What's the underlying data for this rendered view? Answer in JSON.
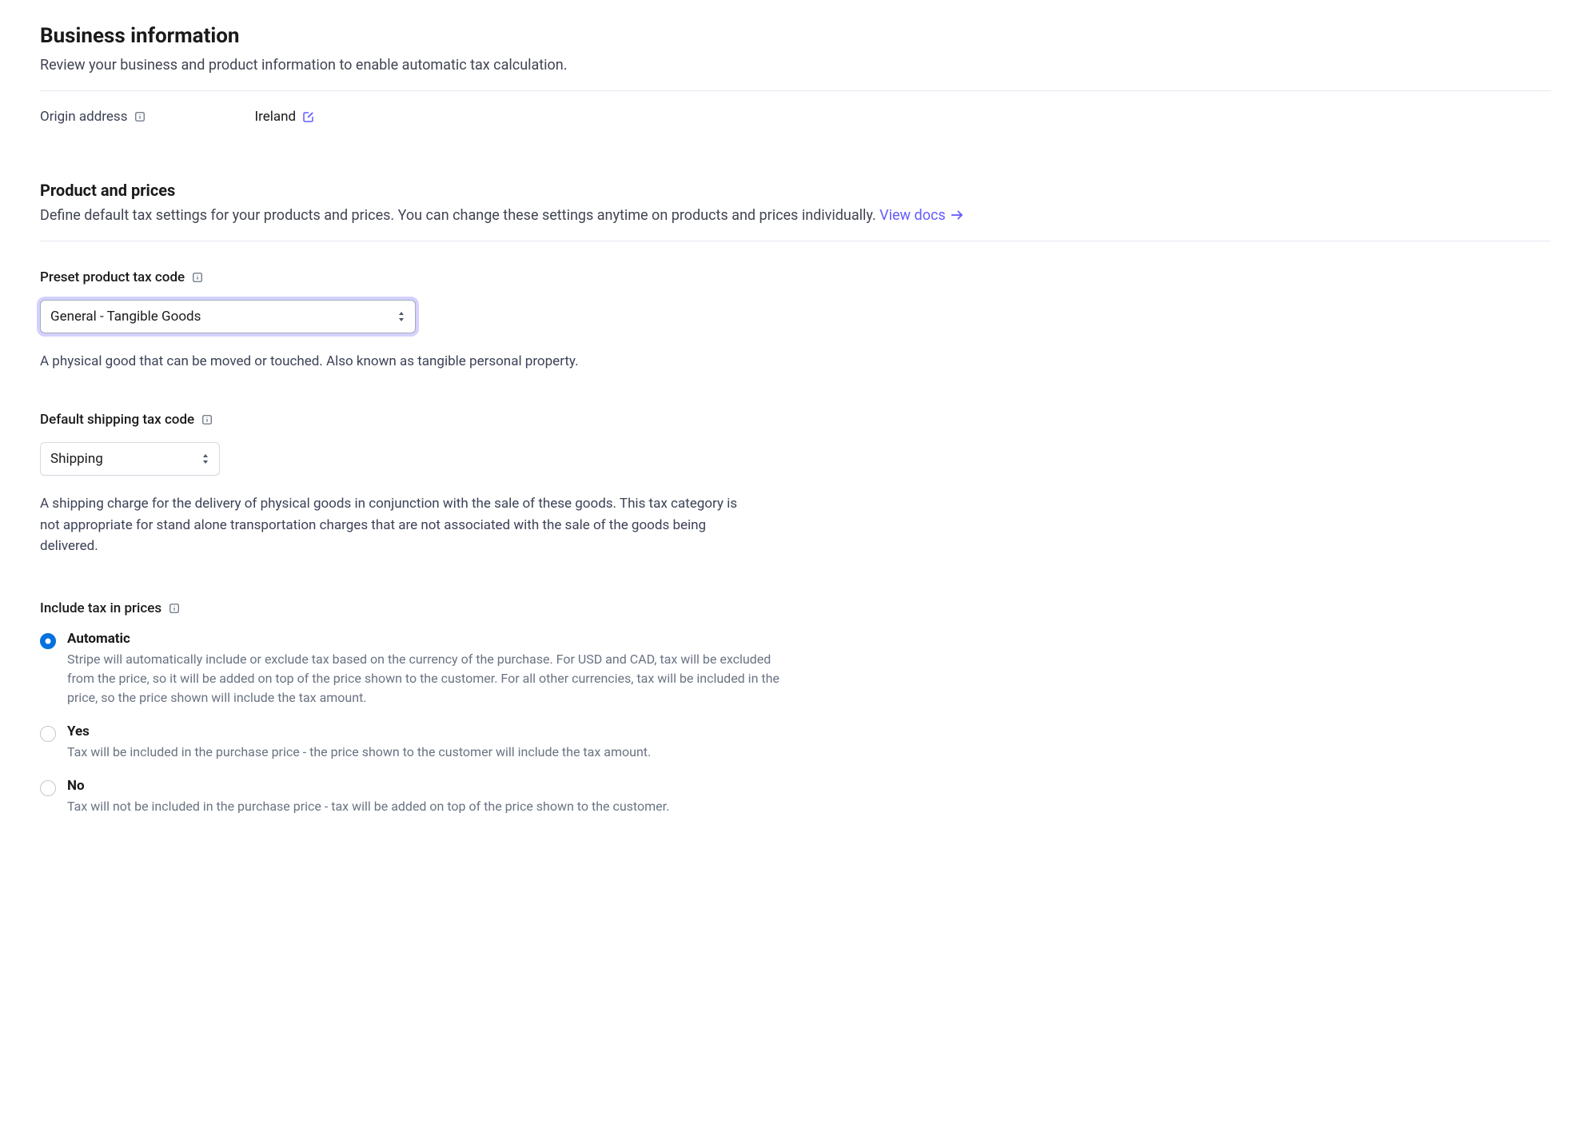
{
  "business": {
    "title": "Business information",
    "desc": "Review your business and product information to enable automatic tax calculation.",
    "origin_label": "Origin address",
    "origin_value": "Ireland"
  },
  "product": {
    "title": "Product and prices",
    "desc": "Define default tax settings for your products and prices. You can change these settings anytime on products and prices individually. ",
    "view_docs": "View docs"
  },
  "preset": {
    "label": "Preset product tax code",
    "value": "General - Tangible Goods",
    "help": "A physical good that can be moved or touched. Also known as tangible personal property."
  },
  "shipping": {
    "label": "Default shipping tax code",
    "value": "Shipping",
    "help": "A shipping charge for the delivery of physical goods in conjunction with the sale of these goods. This tax category is not appropriate for stand alone transportation charges that are not associated with the sale of the goods being delivered."
  },
  "include_tax": {
    "label": "Include tax in prices",
    "options": [
      {
        "title": "Automatic",
        "desc": "Stripe will automatically include or exclude tax based on the currency of the purchase. For USD and CAD, tax will be excluded from the price, so it will be added on top of the price shown to the customer. For all other currencies, tax will be included in the price, so the price shown will include the tax amount.",
        "selected": true
      },
      {
        "title": "Yes",
        "desc": "Tax will be included in the purchase price - the price shown to the customer will include the tax amount.",
        "selected": false
      },
      {
        "title": "No",
        "desc": "Tax will not be included in the purchase price - tax will be added on top of the price shown to the customer.",
        "selected": false
      }
    ]
  }
}
